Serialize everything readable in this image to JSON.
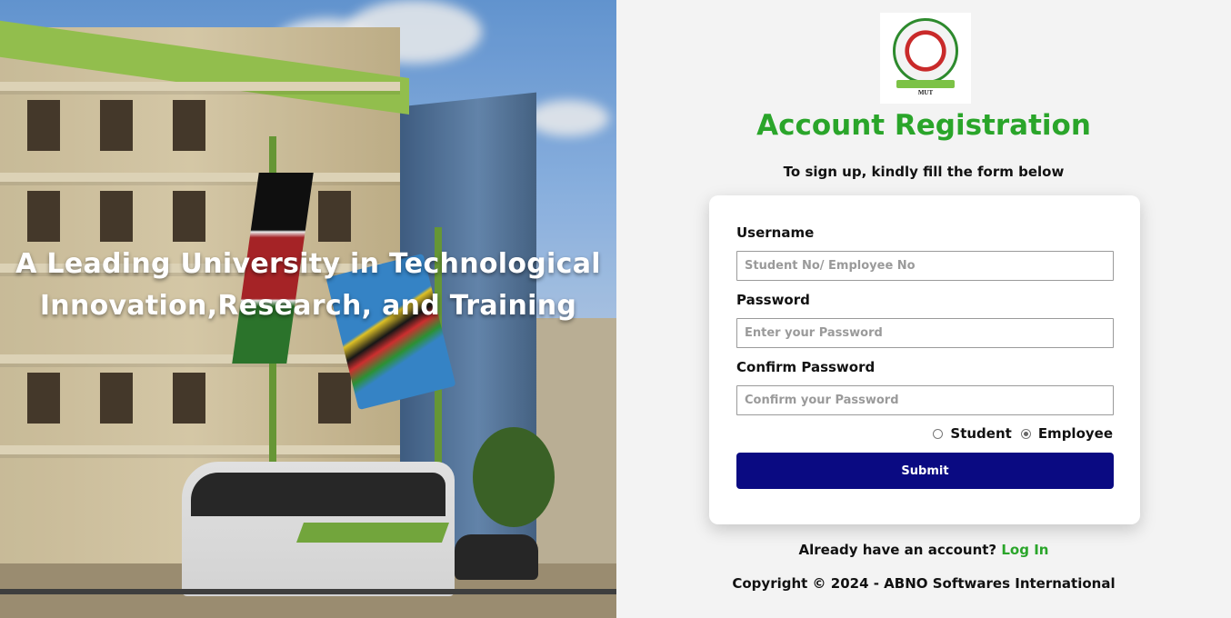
{
  "hero": {
    "tagline_line1": "A Leading University in Technological",
    "tagline_line2": "Innovation,Research, and Training"
  },
  "logo": {
    "text": "MUT"
  },
  "header": {
    "title": "Account Registration",
    "subtitle": "To sign up, kindly fill the form below"
  },
  "form": {
    "username_label": "Username",
    "username_placeholder": "Student No/ Employee No",
    "username_value": "",
    "password_label": "Password",
    "password_placeholder": "Enter your Password",
    "password_value": "",
    "confirm_label": "Confirm Password",
    "confirm_placeholder": "Confirm your Password",
    "confirm_value": "",
    "role_options": [
      "Student",
      "Employee"
    ],
    "role_selected": "Employee",
    "submit_label": "Submit"
  },
  "footer": {
    "already_text": "Already have an account?",
    "login_label": "Log In",
    "copyright": "Copyright © 2024 - ABNO Softwares International"
  },
  "colors": {
    "accent_green": "#2aa52a",
    "submit_navy": "#0a0a82",
    "panel_bg": "#f3f3f3"
  }
}
